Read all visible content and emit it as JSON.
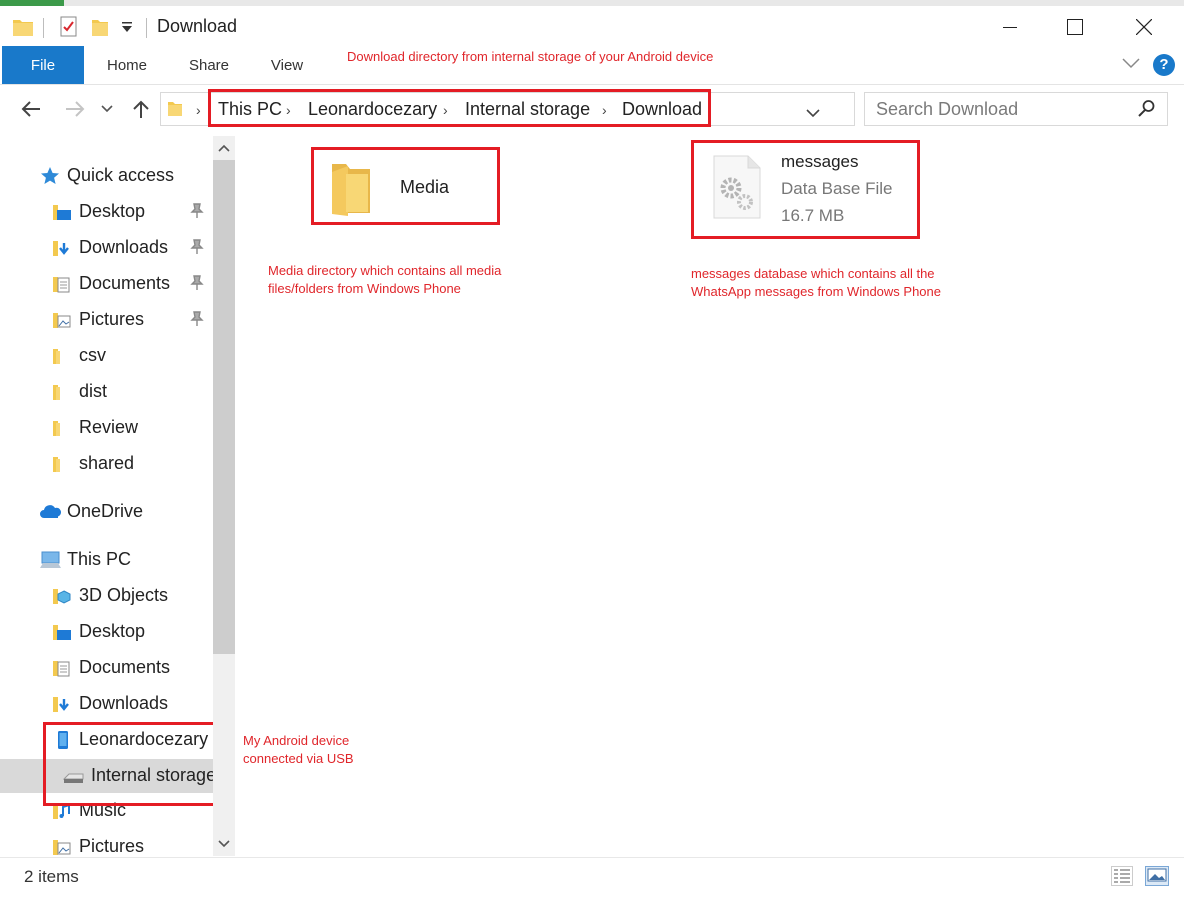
{
  "window": {
    "title": "Download",
    "controls": [
      "minimize",
      "maximize",
      "close"
    ]
  },
  "ribbon": {
    "tabs": [
      "File",
      "Home",
      "Share",
      "View"
    ],
    "annotation": "Download directory from internal storage of your Android device",
    "help_label": "?"
  },
  "address": {
    "breadcrumbs": [
      "This PC",
      "Leonardocezary",
      "Internal storage",
      "Download"
    ],
    "search_placeholder": "Search Download"
  },
  "navigation": {
    "quick_access": {
      "label": "Quick access",
      "items": [
        {
          "label": "Desktop",
          "pinned": true,
          "icon": "desktop-folder-icon"
        },
        {
          "label": "Downloads",
          "pinned": true,
          "icon": "downloads-folder-icon"
        },
        {
          "label": "Documents",
          "pinned": true,
          "icon": "documents-folder-icon"
        },
        {
          "label": "Pictures",
          "pinned": true,
          "icon": "pictures-folder-icon"
        },
        {
          "label": "csv",
          "pinned": false,
          "icon": "folder-icon"
        },
        {
          "label": "dist",
          "pinned": false,
          "icon": "folder-icon"
        },
        {
          "label": "Review",
          "pinned": false,
          "icon": "folder-icon"
        },
        {
          "label": "shared",
          "pinned": false,
          "icon": "folder-icon"
        }
      ]
    },
    "onedrive": {
      "label": "OneDrive"
    },
    "this_pc": {
      "label": "This PC",
      "items": [
        {
          "label": "3D Objects",
          "icon": "3d-objects-icon"
        },
        {
          "label": "Desktop",
          "icon": "desktop-folder-icon"
        },
        {
          "label": "Documents",
          "icon": "documents-folder-icon"
        },
        {
          "label": "Downloads",
          "icon": "downloads-folder-icon"
        },
        {
          "label": "Leonardocezary",
          "icon": "phone-icon"
        },
        {
          "label": "Internal storage",
          "icon": "storage-drive-icon",
          "selected": true
        },
        {
          "label": "Music",
          "icon": "music-folder-icon"
        },
        {
          "label": "Pictures",
          "icon": "pictures-folder-icon"
        }
      ]
    },
    "device_annotation": [
      "My Android device",
      "connected via USB"
    ]
  },
  "content": {
    "items": [
      {
        "name": "Media",
        "type": "folder"
      },
      {
        "name": "messages",
        "type": "Data Base File",
        "size": "16.7 MB"
      }
    ],
    "annotations": {
      "media": [
        "Media directory which contains all media",
        "files/folders from Windows Phone"
      ],
      "messages": [
        "messages database which contains all the",
        "WhatsApp messages from Windows Phone"
      ]
    }
  },
  "status": {
    "item_count": "2 items"
  },
  "colors": {
    "accent": "#1979ca",
    "annotation_red": "#e0262b",
    "folder_yellow": "#f8d775"
  }
}
